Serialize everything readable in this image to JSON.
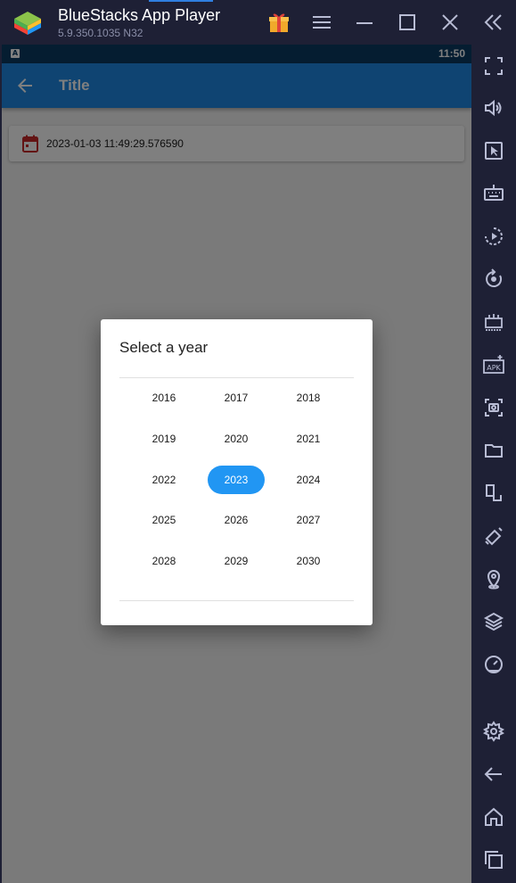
{
  "window": {
    "app_title": "BlueStacks App Player",
    "version": "5.9.350.1035  N32",
    "controls": [
      "gift-icon",
      "menu-icon",
      "minimize-icon",
      "maximize-icon",
      "close-icon",
      "collapse-sidebar-icon"
    ]
  },
  "statusbar": {
    "indicator": "A",
    "time": "11:50"
  },
  "appbar": {
    "title": "Title",
    "back_icon": "arrow-back-icon"
  },
  "date_field": {
    "icon": "calendar-icon",
    "value": "2023-01-03 11:49:29.576590"
  },
  "year_dialog": {
    "title": "Select a year",
    "years": [
      "2016",
      "2017",
      "2018",
      "2019",
      "2020",
      "2021",
      "2022",
      "2023",
      "2024",
      "2025",
      "2026",
      "2027",
      "2028",
      "2029",
      "2030"
    ],
    "selected": "2023"
  },
  "sidebar": {
    "items": [
      "fullscreen-icon",
      "volume-icon",
      "pointer-icon",
      "keyboard-icon",
      "record-icon",
      "rotate-icon",
      "macro-icon",
      "apk-icon",
      "screenshot-icon",
      "folder-icon",
      "multi-instance-icon",
      "eco-mode-icon",
      "location-icon",
      "layers-icon",
      "speed-icon",
      "settings-icon",
      "back-icon",
      "home-icon",
      "recent-apps-icon"
    ]
  },
  "colors": {
    "appbar": "#1e88e5",
    "statusbar": "#0b3a63",
    "selected_year": "#2196f3",
    "calendar_icon": "#c62828",
    "chrome": "#1e2035"
  }
}
